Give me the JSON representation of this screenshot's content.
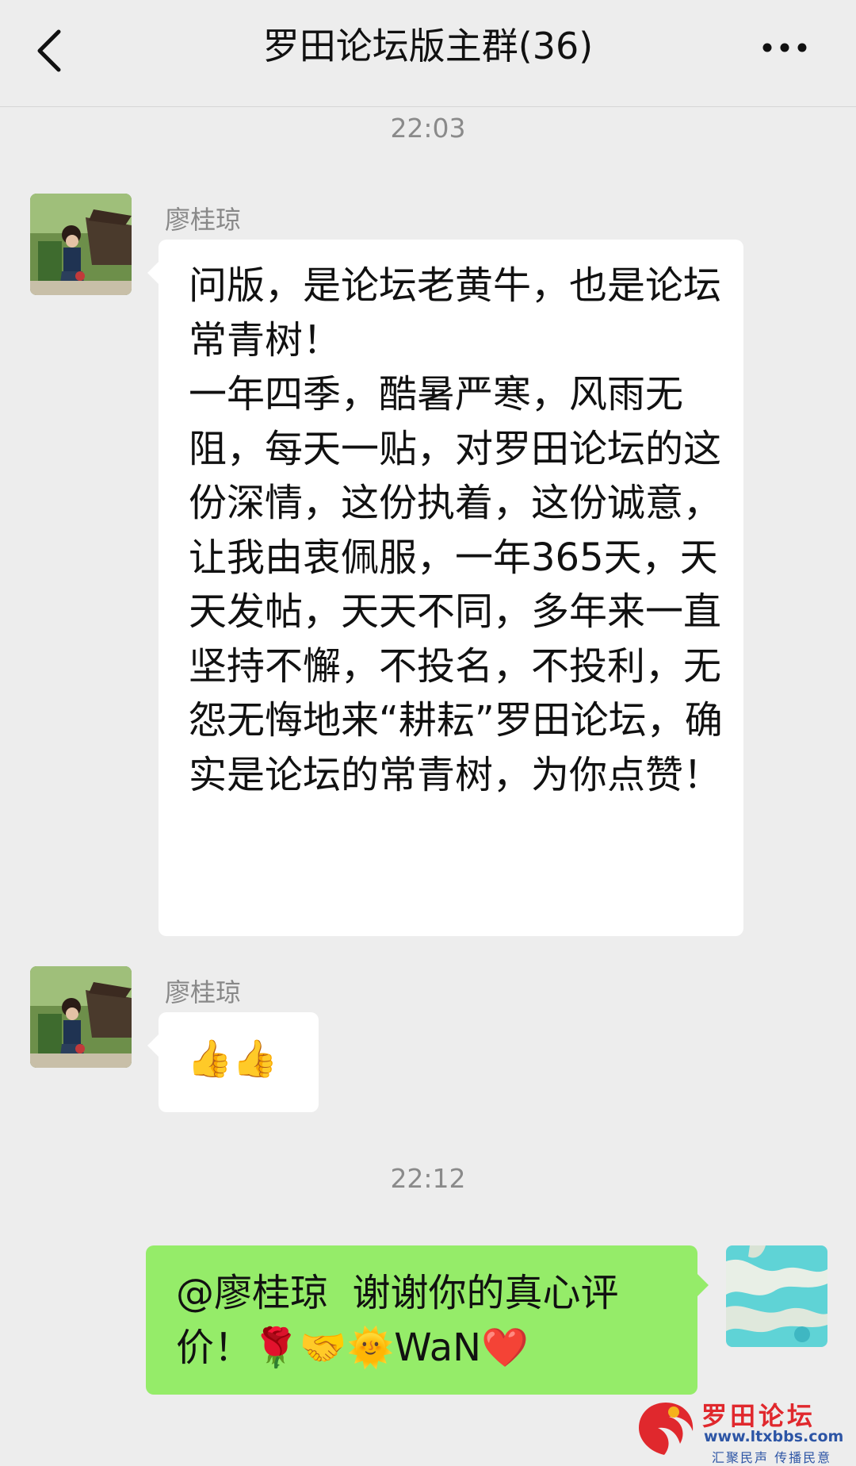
{
  "header": {
    "title": "罗田论坛版主群(36)",
    "back_icon": "chevron-left-icon",
    "more_icon": "more-dots-icon"
  },
  "messages": [
    {
      "type": "time",
      "text": "22:03"
    },
    {
      "type": "incoming",
      "sender": "廖桂琼",
      "text": "问版，是论坛老黄牛，也是论坛常青树！\n一年四季，酷暑严寒，风雨无阻，每天一贴，对罗田论坛的这份深情，这份执着，这份诚意，让我由衷佩服，一年365天，天天发帖，天天不同，多年来一直坚持不懈，不投名，不投利，无怨无悔地来“耕耘”罗田论坛，确实是论坛的常青树，为你点赞！"
    },
    {
      "type": "incoming",
      "sender": "廖桂琼",
      "text": "👍👍"
    },
    {
      "type": "time",
      "text": "22:12"
    },
    {
      "type": "outgoing",
      "text": "@廖桂琼  谢谢你的真心评价！🌹🤝🌞WaN❤️"
    }
  ],
  "watermark": {
    "name": "罗田论坛",
    "url": "www.ltxbbs.com",
    "slogan": "汇聚民声 传播民意"
  },
  "colors": {
    "background": "#ededed",
    "incoming_bubble": "#ffffff",
    "outgoing_bubble": "#95ec69",
    "watermark_red": "#e0282d",
    "watermark_blue": "#2d55a5"
  }
}
